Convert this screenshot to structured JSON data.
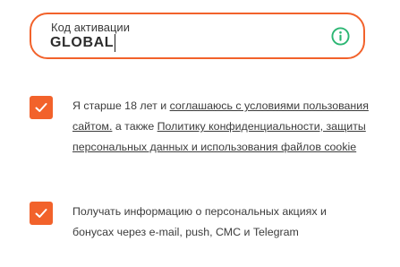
{
  "activation_field": {
    "label": "Код активации",
    "value": "GLOBAL",
    "info_icon": "info-icon"
  },
  "consent_terms": {
    "checked": true,
    "check_icon": "checkmark-icon",
    "text_1": "Я старше 18 лет и ",
    "link_terms": "соглашаюсь с условиями пользования сайтом.",
    "text_2": " а также ",
    "link_privacy": "Политику конфиденциальности, защиты персональных данных и использования файлов cookie"
  },
  "consent_marketing": {
    "checked": true,
    "check_icon": "checkmark-icon",
    "text": "Получать информацию о персональных акциях и бонусах через e-mail, push, СМС и Telegram"
  },
  "colors": {
    "accent": "#f2622b",
    "info_icon": "#2bb673",
    "text": "#3c3c3c"
  }
}
